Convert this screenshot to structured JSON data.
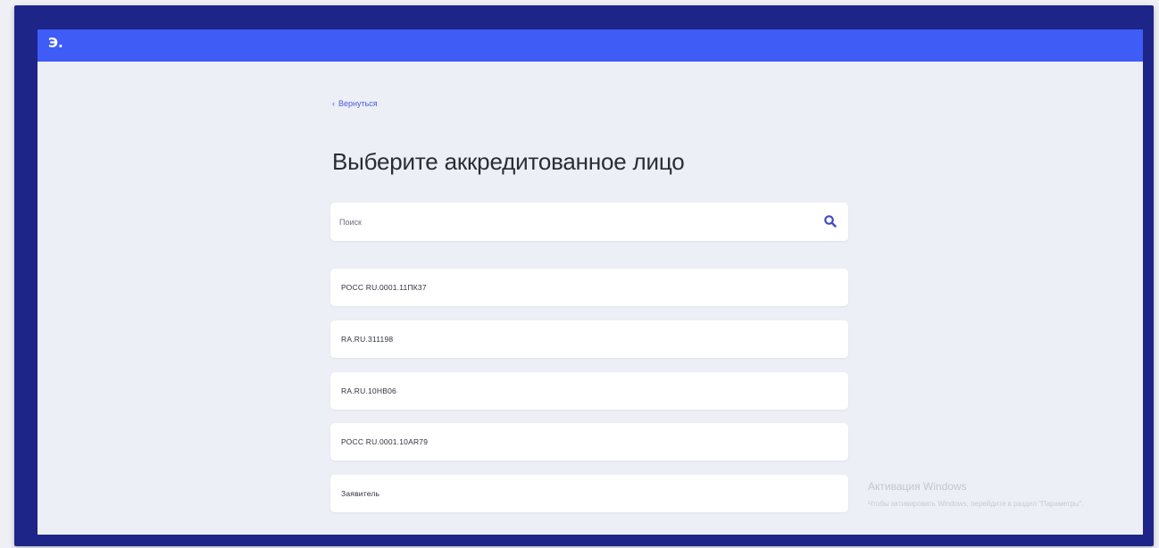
{
  "header": {
    "logo_text": "Э."
  },
  "nav": {
    "back_label": "Вернуться"
  },
  "page": {
    "title": "Выберите аккредитованное лицо"
  },
  "search": {
    "placeholder": "Поиск",
    "value": "",
    "icon": "search-icon"
  },
  "accredited_list": {
    "items": [
      {
        "label": "РОСС RU.0001.11ПК37"
      },
      {
        "label": "RA.RU.311198"
      },
      {
        "label": "RA.RU.10HB06"
      },
      {
        "label": "РОСС RU.0001.10AR79"
      },
      {
        "label": "Заявитель"
      }
    ]
  },
  "system_watermark": {
    "title": "Активация Windows",
    "subtitle": "Чтобы активировать Windows, перейдите в раздел \"Параметры\"."
  },
  "colors": {
    "topbar": "#3f5cf6",
    "frame": "#1e2588",
    "background": "#eceff6",
    "accent": "#4a5bd8"
  }
}
